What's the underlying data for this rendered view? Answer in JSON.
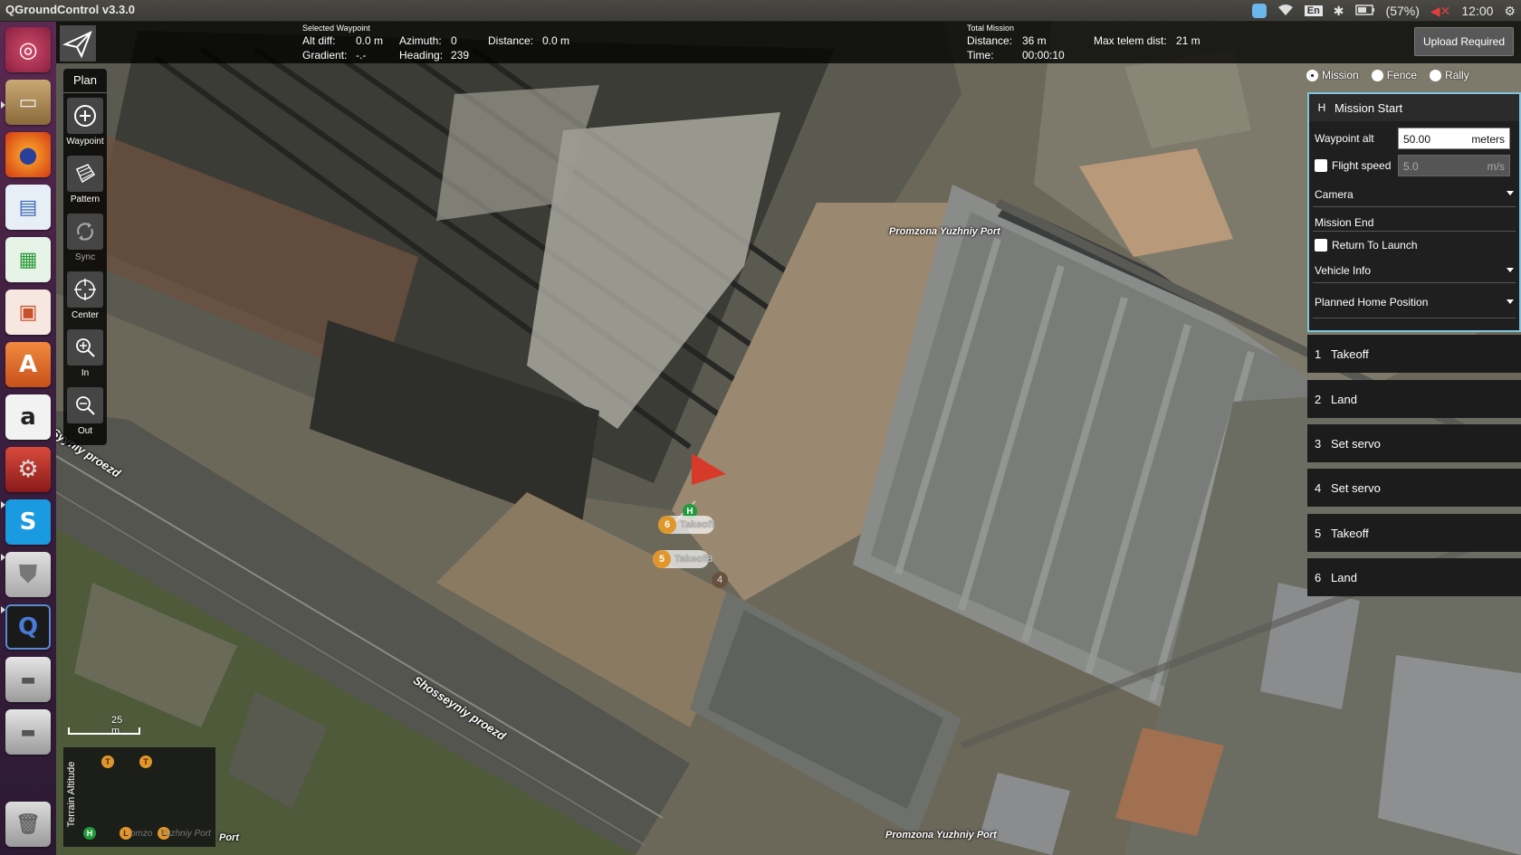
{
  "window": {
    "title": "QGroundControl v3.3.0"
  },
  "tray": {
    "lang": "En",
    "battery": "(57%)",
    "clock": "12:00"
  },
  "header": {
    "selected_label": "Selected Waypoint",
    "alt_diff_label": "Alt diff:",
    "alt_diff": "0.0 m",
    "gradient_label": "Gradient:",
    "gradient": "-.-",
    "azimuth_label": "Azimuth:",
    "azimuth": "0",
    "heading_label": "Heading:",
    "heading": "239",
    "distance_label": "Distance:",
    "distance": "0.0 m",
    "total_label": "Total Mission",
    "total_distance_label": "Distance:",
    "total_distance": "36 m",
    "time_label": "Time:",
    "time": "00:00:10",
    "max_telem_label": "Max telem dist:",
    "max_telem": "21 m",
    "upload_label": "Upload Required"
  },
  "toolbar": {
    "title": "Plan",
    "tools": [
      {
        "label": "Waypoint",
        "icon": "plus-circle-icon"
      },
      {
        "label": "Pattern",
        "icon": "pattern-icon"
      },
      {
        "label": "Sync",
        "icon": "sync-icon"
      },
      {
        "label": "Center",
        "icon": "crosshair-icon"
      },
      {
        "label": "In",
        "icon": "zoom-in-icon"
      },
      {
        "label": "Out",
        "icon": "zoom-out-icon"
      }
    ]
  },
  "modes": {
    "mission": "Mission",
    "fence": "Fence",
    "rally": "Rally",
    "selected": "Mission"
  },
  "mission_start": {
    "badge": "H",
    "title": "Mission Start",
    "waypoint_alt_label": "Waypoint alt",
    "waypoint_alt_value": "50.00",
    "waypoint_alt_unit": "meters",
    "flight_speed_label": "Flight speed",
    "flight_speed_value": "5.0",
    "flight_speed_unit": "m/s",
    "camera_label": "Camera",
    "mission_end_label": "Mission End",
    "return_to_launch_label": "Return To Launch",
    "vehicle_info_label": "Vehicle Info",
    "planned_home_label": "Planned Home Position"
  },
  "mission_items": [
    {
      "num": "1",
      "cmd": "Takeoff"
    },
    {
      "num": "2",
      "cmd": "Land"
    },
    {
      "num": "3",
      "cmd": "Set servo"
    },
    {
      "num": "4",
      "cmd": "Set servo"
    },
    {
      "num": "5",
      "cmd": "Takeoff"
    },
    {
      "num": "6",
      "cmd": "Land"
    }
  ],
  "map": {
    "labels": [
      "Promzona Yuzhniy Port",
      "Shosseyniy proezd",
      "Syyniy proezd",
      "Promzona Yuzhniy Port",
      "Port"
    ],
    "scale": "25 m",
    "markers": [
      {
        "num": "6",
        "text": "Takeoff"
      },
      {
        "num": "5",
        "text": "TakeofB"
      },
      {
        "num": "4",
        "text": "4"
      },
      {
        "home": "H"
      }
    ]
  },
  "terrain": {
    "label": "Terrain Altitude",
    "dots": [
      "T",
      "T",
      "H",
      "L",
      "L"
    ],
    "overlay_text": "omzo   Yuzhniy Port"
  }
}
